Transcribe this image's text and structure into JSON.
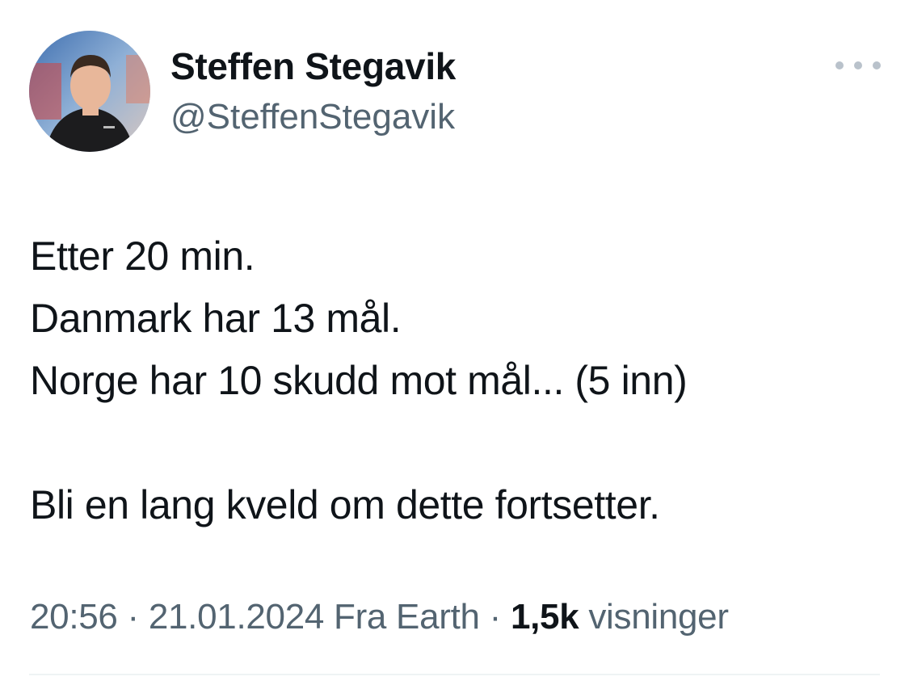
{
  "author": {
    "display_name": "Steffen Stegavik",
    "handle": "@SteffenStegavik",
    "avatar_icon": "profile-photo"
  },
  "more_icon": "more-horizontal-icon",
  "tweet": {
    "lines": [
      "Etter 20 min.",
      "Danmark har 13 mål.",
      "Norge har 10 skudd mot mål... (5 inn)",
      "Bli en lang kveld om dette fortsetter."
    ]
  },
  "meta": {
    "time": "20:56",
    "separator": "·",
    "date": "21.01.2024",
    "source": "Fra Earth",
    "views_count": "1,5k",
    "views_label": "visninger"
  },
  "colors": {
    "text": "#0f1419",
    "secondary": "#536471",
    "divider": "#eff3f4"
  }
}
